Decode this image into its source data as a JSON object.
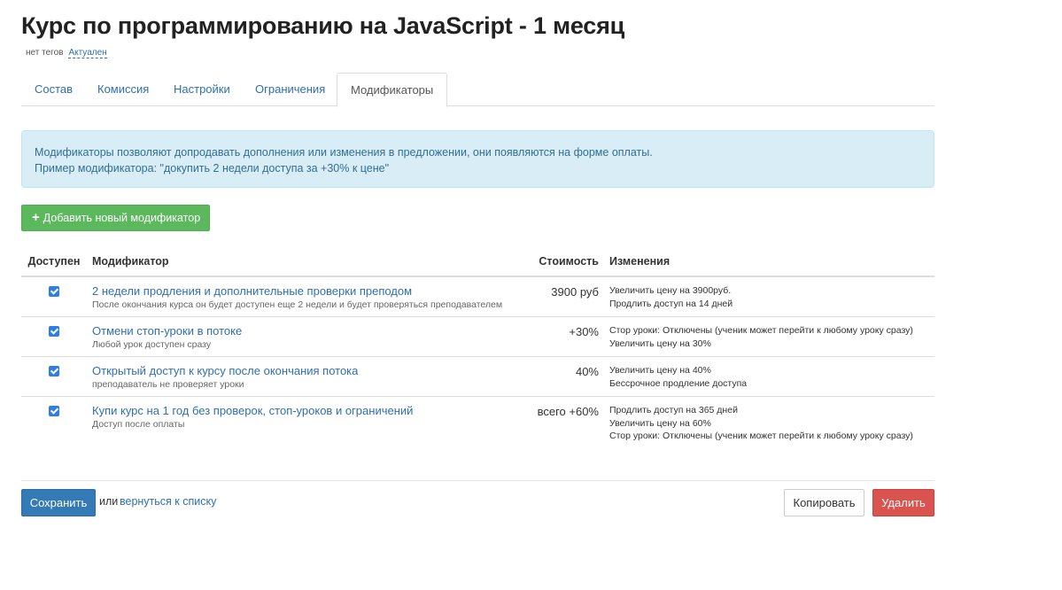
{
  "page": {
    "title": "Курс по программированию на JavaScript - 1 месяц",
    "tags_label": "нет тегов",
    "status_label": "Актуален"
  },
  "tabs": [
    {
      "label": "Состав",
      "active": false
    },
    {
      "label": "Комиссия",
      "active": false
    },
    {
      "label": "Настройки",
      "active": false
    },
    {
      "label": "Ограничения",
      "active": false
    },
    {
      "label": "Модификаторы",
      "active": true
    }
  ],
  "info": {
    "line1": "Модификаторы позволяют допродавать дополнения или изменения в предложении, они появляются на форме оплаты.",
    "line2": "Пример модификатора: \"докупить 2 недели доступа за +30% к цене\""
  },
  "add_button": {
    "icon": "plus-icon",
    "label": "Добавить новый модификатор"
  },
  "table": {
    "headers": {
      "available": "Доступен",
      "modifier": "Модификатор",
      "price": "Стоимость",
      "changes": "Изменения"
    },
    "rows": [
      {
        "checked": true,
        "name": "2 недели продления и дополнительные проверки преподом",
        "description": "После окончания курса он будет доступен еще 2 недели и будет проверяться преподавателем",
        "price": "3900 руб",
        "changes": [
          "Увеличить цену на 3900руб.",
          "Продлить доступ на 14 дней"
        ]
      },
      {
        "checked": true,
        "name": "Отмени стоп-уроки в потоке",
        "description": "Любой урок доступен сразу",
        "price": "+30%",
        "changes": [
          "Стор уроки: Отключены (ученик может перейти к любому уроку сразу)",
          "Увеличить цену на 30%"
        ]
      },
      {
        "checked": true,
        "name": "Открытый доступ к курсу после окончания потока",
        "description": "преподаватель не проверяет уроки",
        "price": "40%",
        "changes": [
          "Увеличить цену на 40%",
          "Бессрочное продление доступа"
        ]
      },
      {
        "checked": true,
        "name": "Купи курс на 1 год без проверок, стоп-уроков и ограничений",
        "description": "Доступ после оплаты",
        "price": "всего +60%",
        "changes": [
          "Продлить доступ на 365 дней",
          "Увеличить цену на 60%",
          "Стор уроки: Отключены (ученик может перейти к любому уроку сразу)"
        ]
      }
    ]
  },
  "footer": {
    "save_label": "Сохранить",
    "or_text": "или",
    "back_label": "вернуться к списку",
    "copy_label": "Копировать",
    "delete_label": "Удалить"
  },
  "colors": {
    "primary": "#337ab7",
    "success": "#5cb85c",
    "danger": "#d9534f",
    "link": "#2f6fb0",
    "info_bg": "#d9edf7",
    "checkbox": "#2d7fe6"
  }
}
